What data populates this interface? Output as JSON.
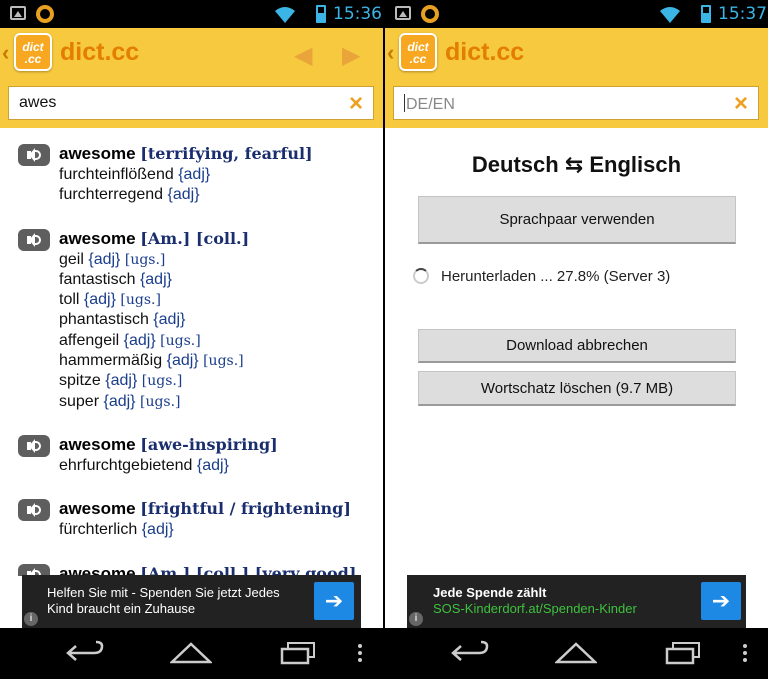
{
  "status": {
    "left_time": "15:36",
    "right_time": "15:37",
    "status_color": "#3ab5e6"
  },
  "app": {
    "title": "dict.cc",
    "logo_line1": "dict",
    "logo_line2": ".cc",
    "accent": "#f7c93f",
    "title_color": "#e37e00"
  },
  "left": {
    "search_value": "awes",
    "clear_icon": "×",
    "entries": [
      {
        "word": "awesome",
        "context": "[terrifying, fearful]",
        "translations": [
          {
            "text": "furchteinflößend",
            "gram": "{adj}",
            "usage": ""
          },
          {
            "text": "furchterregend",
            "gram": "{adj}",
            "usage": ""
          }
        ]
      },
      {
        "word": "awesome",
        "context": "[Am.] [coll.]",
        "translations": [
          {
            "text": "geil",
            "gram": "{adj}",
            "usage": "[ugs.]"
          },
          {
            "text": "fantastisch",
            "gram": "{adj}",
            "usage": ""
          },
          {
            "text": "toll",
            "gram": "{adj}",
            "usage": "[ugs.]"
          },
          {
            "text": "phantastisch",
            "gram": "{adj}",
            "usage": ""
          },
          {
            "text": "affengeil",
            "gram": "{adj}",
            "usage": "[ugs.]"
          },
          {
            "text": "hammermäßig",
            "gram": "{adj}",
            "usage": "[ugs.]"
          },
          {
            "text": "spitze",
            "gram": "{adj}",
            "usage": "[ugs.]"
          },
          {
            "text": "super",
            "gram": "{adj}",
            "usage": "[ugs.]"
          }
        ]
      },
      {
        "word": "awesome",
        "context": "[awe-inspiring]",
        "translations": [
          {
            "text": "ehrfurchtgebietend",
            "gram": "{adj}",
            "usage": ""
          }
        ]
      },
      {
        "word": "awesome",
        "context": "[frightful / frightening]",
        "translations": [
          {
            "text": "fürchterlich",
            "gram": "{adj}",
            "usage": ""
          }
        ]
      },
      {
        "word": "awesome",
        "context": "[Am.] [coll.] [very good]",
        "translations": []
      }
    ],
    "ad": {
      "text": "Helfen Sie mit - Spenden Sie jetzt Jedes Kind braucht ein Zuhause",
      "info": "i",
      "arrow": "➔"
    }
  },
  "right": {
    "search_placeholder": "DE/EN",
    "clear_icon": "×",
    "lang_title": "Deutsch ⇆ Englisch",
    "use_pair_button": "Sprachpaar verwenden",
    "progress_text": "Herunterladen ... 27.8% (Server 3)",
    "progress_percent": 27.8,
    "cancel_button": "Download abbrechen",
    "delete_button": "Wortschatz löschen (9.7 MB)",
    "ad": {
      "title": "Jede Spende zählt",
      "url": "SOS-Kinderdorf.at/Spenden-Kinder",
      "info": "i",
      "arrow": "➔"
    }
  },
  "nav": {
    "back": "back-icon",
    "home": "home-icon",
    "recents": "recent-apps-icon",
    "menu": "overflow-menu-icon"
  }
}
